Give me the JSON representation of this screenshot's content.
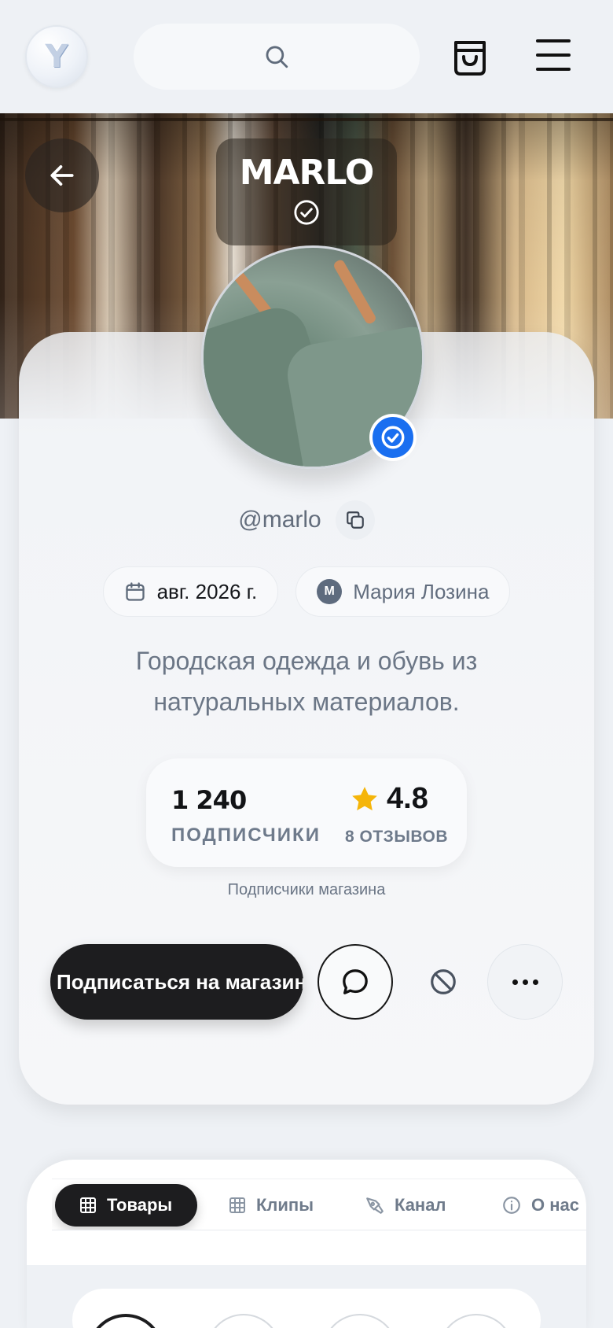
{
  "header": {
    "logo_letter": "Y",
    "icons": [
      "search-icon",
      "shopping-bag-icon",
      "hamburger-menu-icon"
    ]
  },
  "cover": {
    "store_name": "MARLO",
    "icons": [
      "arrow-left-icon",
      "check-circle-icon"
    ]
  },
  "profile": {
    "handle": "@marlo",
    "joined": "авг. 2026 г.",
    "owner_initial": "M",
    "owner_name": "Мария Лозина",
    "bio": "Городская одежда и обувь из натуральных материалов.",
    "verified_color": "#1a6ff0"
  },
  "stats": {
    "followers_count": "1 240",
    "followers_label": "ПОДПИСЧИКИ",
    "rating": "4.8",
    "reviews_label": "8 ОТЗЫВОВ",
    "caption": "Подписчики магазина",
    "star_color": "#f5b50a"
  },
  "actions": {
    "subscribe_label": "Подписаться на магазин",
    "icons": [
      "chat-bubble-icon",
      "block-icon",
      "more-dots-icon"
    ]
  },
  "tabs": [
    {
      "label": "Товары",
      "icon": "grid-icon",
      "active": true
    },
    {
      "label": "Клипы",
      "icon": "grid-icon",
      "active": false
    },
    {
      "label": "Канал",
      "icon": "pen-nib-icon",
      "active": false
    },
    {
      "label": "О нас",
      "icon": "info-icon",
      "active": false
    }
  ]
}
